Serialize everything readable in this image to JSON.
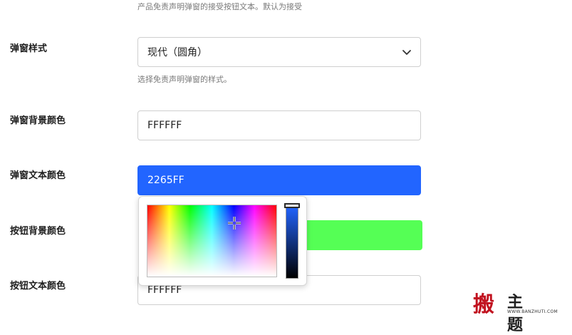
{
  "top_hint": "产品免责声明弹窗的接受按钮文本。默认为接受",
  "popup_style": {
    "label": "弹窗样式",
    "value": "现代（圆角）",
    "hint": "选择免责声明弹窗的样式。"
  },
  "popup_bg_color": {
    "label": "弹窗背景颜色",
    "value": "FFFFFF"
  },
  "popup_text_color": {
    "label": "弹窗文本颜色",
    "value": "2265FF",
    "color": "#2265FF"
  },
  "button_bg_color": {
    "label": "按钮背景颜色",
    "color": "#55FF55"
  },
  "button_text_color": {
    "label": "按钮文本颜色",
    "value": "FFFFFF"
  },
  "watermark": {
    "name": "主题",
    "mark": "搬",
    "url": "WWW.BANZHUTI.COM"
  }
}
